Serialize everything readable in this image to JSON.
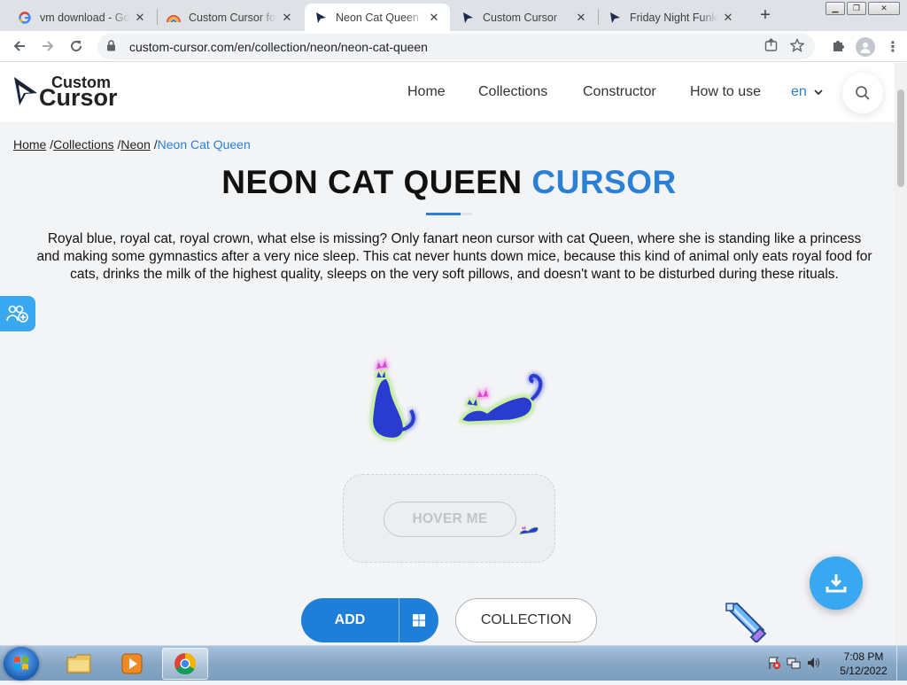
{
  "browser": {
    "tabs": [
      {
        "title": "vm download - Goo",
        "icon": "google-icon"
      },
      {
        "title": "Custom Cursor for",
        "icon": "custom-cursor-rainbow-icon"
      },
      {
        "title": "Neon Cat Queen c",
        "icon": "custom-cursor-arrow-icon"
      },
      {
        "title": "Custom Cursor",
        "icon": "custom-cursor-arrow-icon"
      },
      {
        "title": "Friday Night Funkin",
        "icon": "custom-cursor-arrow-icon"
      }
    ],
    "url": "custom-cursor.com/en/collection/neon/neon-cat-queen"
  },
  "site": {
    "logo_top": "Custom",
    "logo_bottom": "Cursor",
    "nav": [
      "Home",
      "Collections",
      "Constructor",
      "How to use"
    ],
    "lang": "en"
  },
  "breadcrumb": {
    "home": "Home",
    "collections": "Collections",
    "neon": "Neon",
    "current": "Neon Cat Queen"
  },
  "hero": {
    "title_main": "NEON CAT QUEEN",
    "title_accent": "CURSOR",
    "description": "Royal blue, royal cat, royal crown, what else is missing? Only fanart neon cursor with cat Queen, where she is standing like a princess and making some gymnastics after a very nice sleep. This cat never hunts down mice, because this kind of animal only eats royal food for cats, drinks the milk of the highest quality, sleeps on the very soft pillows, and doesn't want to be disturbed during these rituals."
  },
  "actions": {
    "hover_label": "HOVER ME",
    "add_label": "ADD",
    "collection_label": "COLLECTION"
  },
  "taskbar": {
    "time": "7:08 PM",
    "date": "5/12/2022"
  },
  "colors": {
    "accent": "#2b7fd4",
    "add_button": "#1f7fd8",
    "floating_button": "#3aa8f0"
  }
}
